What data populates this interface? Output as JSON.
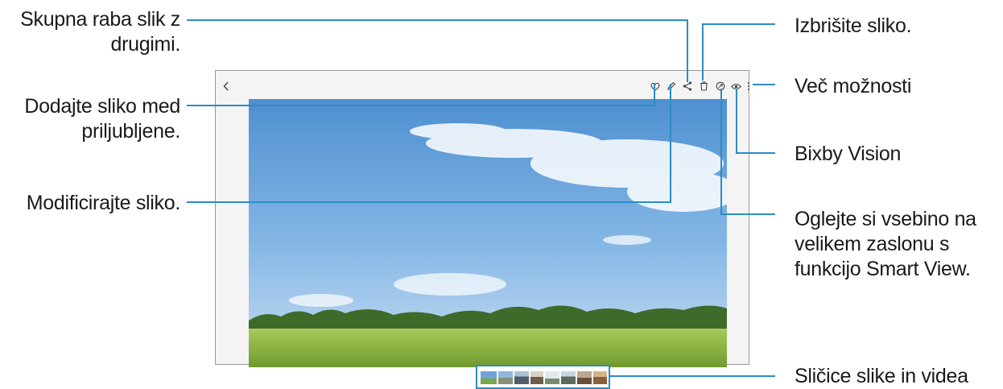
{
  "callouts": {
    "share": {
      "lines": [
        "Skupna raba slik z",
        "drugimi."
      ]
    },
    "favorite": {
      "lines": [
        "Dodajte sliko med",
        "priljubljene."
      ]
    },
    "edit": {
      "lines": [
        "Modificirajte sliko."
      ]
    },
    "delete": {
      "lines": [
        "Izbrišite sliko."
      ]
    },
    "more": {
      "lines": [
        "Več možnosti"
      ]
    },
    "bixby": {
      "lines": [
        "Bixby Vision"
      ]
    },
    "smartview": {
      "lines": [
        "Oglejte si vsebino na",
        "velikem zaslonu s",
        "funkcijo Smart View."
      ]
    },
    "thumbnails": {
      "lines": [
        "Sličice slike in videa"
      ]
    }
  },
  "toolbar": {
    "icons": [
      "back-icon",
      "heart-icon",
      "pencil-icon",
      "share-icon",
      "trash-icon",
      "smart-view-icon",
      "eye-icon",
      "more-vert-icon"
    ]
  },
  "colors": {
    "leader_line": "#2a8dc5",
    "frame": "#9a9a9a",
    "sky": "#6fa4d8",
    "field": "#9cc24a"
  }
}
